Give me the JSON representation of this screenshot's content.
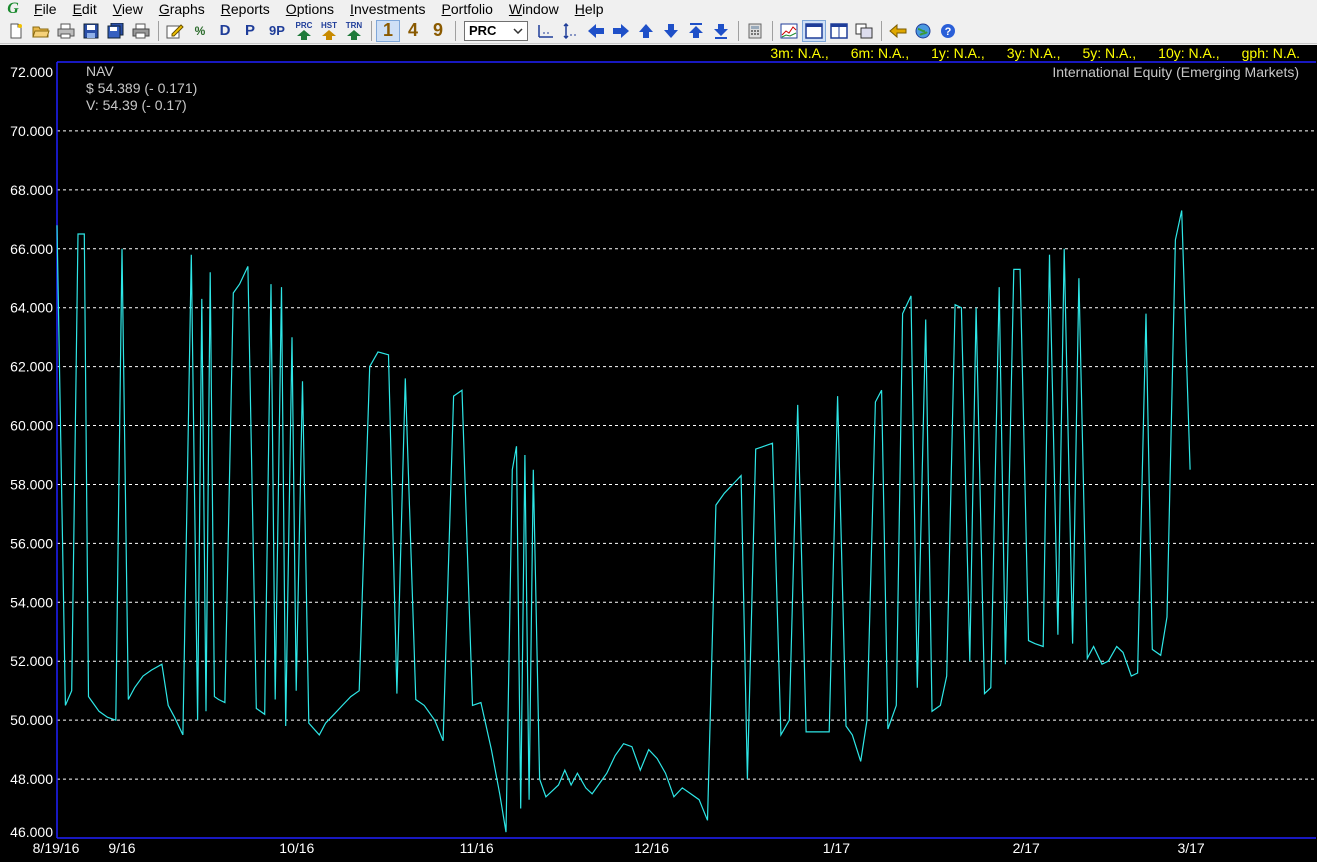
{
  "menu": {
    "items": [
      {
        "label": "File",
        "accel": "F",
        "rest": "ile"
      },
      {
        "label": "Edit",
        "accel": "E",
        "rest": "dit"
      },
      {
        "label": "View",
        "accel": "V",
        "rest": "iew"
      },
      {
        "label": "Graphs",
        "accel": "G",
        "rest": "raphs"
      },
      {
        "label": "Reports",
        "accel": "R",
        "rest": "eports"
      },
      {
        "label": "Options",
        "accel": "O",
        "rest": "ptions"
      },
      {
        "label": "Investments",
        "accel": "I",
        "rest": "nvestments"
      },
      {
        "label": "Portfolio",
        "accel": "P",
        "rest": "ortfolio"
      },
      {
        "label": "Window",
        "accel": "W",
        "rest": "indow"
      },
      {
        "label": "Help",
        "accel": "H",
        "rest": "elp"
      }
    ]
  },
  "toolbar": {
    "text_buttons": {
      "d": "D",
      "p": "P",
      "nine_p": "9P",
      "prc": "PRC",
      "hst": "HST",
      "trn": "TRN"
    },
    "period_buttons": [
      "1",
      "4",
      "9"
    ],
    "select_value": "PRC",
    "percent_label": "%"
  },
  "stats": [
    "3m: N.A.,",
    "6m: N.A.,",
    "1y: N.A.,",
    "3y: N.A.,",
    "5y: N.A.,",
    "10y: N.A.,",
    "gph: N.A."
  ],
  "chart_info": {
    "series_label": "NAV",
    "price_line": "$ 54.389 (- 0.171)",
    "value_line": "V: 54.39 (- 0.17)",
    "category": "International Equity (Emerging Markets)"
  },
  "colors": {
    "line": "#2ee6e6",
    "grid": "#ffffff",
    "axis": "#2020ff",
    "stats": "#ffff00"
  },
  "chart_data": {
    "type": "line",
    "title": "",
    "ylim": [
      46.0,
      72.0
    ],
    "y_ticks": [
      "72.000",
      "70.000",
      "68.000",
      "66.000",
      "64.000",
      "62.000",
      "60.000",
      "58.000",
      "56.000",
      "54.000",
      "52.000",
      "50.000",
      "48.000",
      "46.000"
    ],
    "x_ticks": [
      "8/19/16",
      "9/16",
      "10/16",
      "11/16",
      "12/16",
      "1/17",
      "2/17",
      "3/17"
    ],
    "x_tick_day_index": [
      0,
      13,
      48,
      84,
      119,
      156,
      194,
      227
    ],
    "n_points": 253,
    "series": [
      {
        "values": [
          66.8,
          50.5,
          51.0,
          66.5,
          66.5,
          50.8,
          50.6,
          50.3,
          50.1,
          50.0,
          66.0,
          50.7,
          51.1,
          51.5,
          51.7,
          51.9,
          50.5,
          50.1,
          49.5,
          65.8,
          50.0,
          64.3,
          50.3,
          65.2,
          50.8,
          50.7,
          50.6,
          64.5,
          64.8,
          65.4,
          50.4,
          50.2,
          64.8,
          50.7,
          64.7,
          49.8,
          63.0,
          51.0,
          61.5,
          49.9,
          49.5,
          49.9,
          50.2,
          50.5,
          50.8,
          51.0,
          62.0,
          62.5,
          62.4,
          50.9,
          61.6,
          50.7,
          50.5,
          50.0,
          49.3,
          61.0,
          61.2,
          50.5,
          50.6,
          49.0,
          47.5,
          46.2,
          58.5,
          59.3,
          47.0,
          59.0,
          47.3,
          58.5,
          48.0,
          47.4,
          47.6,
          47.8,
          48.3,
          47.8,
          48.2,
          47.7,
          47.5,
          47.8,
          48.2,
          48.8,
          49.2,
          49.1,
          48.3,
          49.0,
          48.7,
          48.2,
          47.4,
          47.7,
          47.5,
          47.3,
          46.6,
          57.3,
          57.7,
          58.0,
          58.3,
          48.0,
          59.2,
          59.3,
          59.4,
          49.5,
          50.0,
          60.7,
          49.6,
          49.6,
          49.6,
          49.6,
          61.0,
          49.8,
          49.5,
          48.6,
          50.0,
          60.8,
          61.2,
          49.7,
          50.5,
          63.8,
          64.4,
          51.1,
          63.6,
          50.3,
          50.5,
          51.5,
          64.1,
          64.0,
          52.0,
          64.0,
          50.9,
          51.1,
          64.7,
          51.9,
          65.3,
          65.3,
          52.7,
          52.6,
          52.5,
          65.8,
          52.9,
          66.0,
          52.6,
          65.0,
          52.1,
          52.5,
          51.9,
          52.0,
          52.5,
          52.3,
          51.5,
          51.6,
          63.8,
          52.4,
          52.2,
          53.5,
          66.3,
          67.3,
          58.5
        ],
        "samples": [
          0,
          4,
          7,
          10,
          13,
          15,
          17,
          20,
          24,
          28,
          31,
          34,
          37,
          41,
          45,
          50,
          53,
          56,
          60,
          64,
          67,
          69,
          71,
          73,
          75,
          77,
          80,
          84,
          87,
          91,
          95,
          99,
          102,
          104,
          107,
          109,
          112,
          114,
          117,
          120,
          125,
          128,
          132,
          136,
          140,
          144,
          149,
          153,
          158,
          162,
          166,
          171,
          175,
          180,
          184,
          189,
          193,
          198,
          202,
          207,
          211,
          214,
          217,
          219,
          221,
          223,
          225,
          227,
          230,
          233,
          236,
          239,
          242,
          245,
          248,
          252,
          255,
          258,
          262,
          266,
          270,
          274,
          278,
          282,
          286,
          290,
          294,
          298,
          302,
          306,
          310,
          314,
          318,
          322,
          326,
          329,
          333,
          337,
          341,
          345,
          349,
          353,
          357,
          361,
          365,
          368,
          372,
          376,
          379,
          383,
          386,
          390,
          393,
          396,
          400,
          403,
          407,
          410,
          414,
          417,
          421,
          424,
          428,
          431,
          435,
          438,
          442,
          445,
          449,
          452,
          456,
          459,
          463,
          466,
          470,
          473,
          477,
          480,
          484,
          487,
          491,
          494,
          498,
          501,
          505,
          508,
          512,
          515,
          519,
          522,
          526,
          529,
          533,
          536,
          540,
          543,
          547,
          550,
          554,
          557,
          561,
          564,
          568,
          572,
          576,
          580,
          584,
          588,
          592,
          596,
          600
        ]
      }
    ]
  }
}
